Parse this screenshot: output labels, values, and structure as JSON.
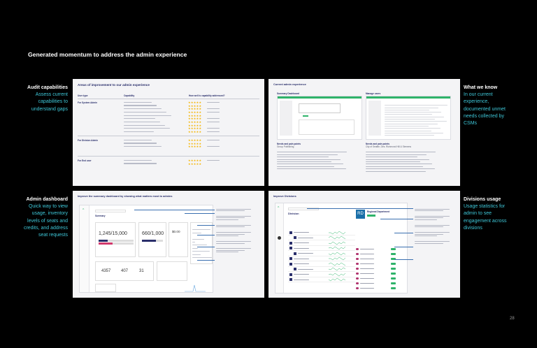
{
  "slide": {
    "title": "Generated momentum to address the admin experience",
    "page_number": "28"
  },
  "labels": {
    "audit": {
      "heading": "Audit capabilities",
      "body": [
        "Assess current",
        "capabilities to",
        "understand gaps"
      ]
    },
    "what_we_know": {
      "heading": "What we know",
      "body": [
        "In our current",
        "experience,",
        "documented unmet",
        "needs collected by",
        "CSMs"
      ]
    },
    "admin_dashboard": {
      "heading": "Admin dashboard",
      "body": [
        "Quick way to view",
        "usage, inventory",
        "levels of seats and",
        "credits, and address",
        "seat requests"
      ]
    },
    "divisions_usage": {
      "heading": "Divisions usage",
      "body": [
        "Usage statistics for",
        "admin to see",
        "engagement across",
        "divisions"
      ]
    }
  },
  "panel_audit": {
    "title": "Areas of improvement to our admin experience",
    "columns": [
      "User type",
      "Capability",
      "How well is capability addressed?"
    ],
    "groups": [
      {
        "user": "For System Admin",
        "rows": 10
      },
      {
        "user": "For Division Admin",
        "rows": 3
      },
      {
        "user": "For End user",
        "rows": 2
      }
    ]
  },
  "panel_current": {
    "title": "Current admin experience",
    "left_sub": "Summary Dashboard",
    "right_sub": "Manage users",
    "left_note_title": "Needs and pain points",
    "left_note_sub": "Group Publishing",
    "right_note_title": "Needs and pain points",
    "right_note_sub": "City of Seattle, Des. Richmond Hill & Siemens"
  },
  "panel_dashboard": {
    "title": "Improve the summary dashboard by showing what matters most to admins",
    "card_title": "Summary",
    "big_number_1": "1,245/15,000",
    "big_number_2": "660/1,000",
    "big_number_3": "$0.00",
    "stat_1": "4357",
    "stat_2": "407",
    "stat_3": "31"
  },
  "panel_divisions": {
    "title": "Improve Divisions",
    "header": "Division",
    "division_name": "Regional Department",
    "avatar_initials": "RD"
  },
  "colors": {
    "background": "#000000",
    "accent_teal": "#3ec7d8",
    "panel_bg": "#f4f4f6",
    "navy": "#2a2f6b",
    "star": "#f5b400",
    "green": "#2fb36a"
  }
}
